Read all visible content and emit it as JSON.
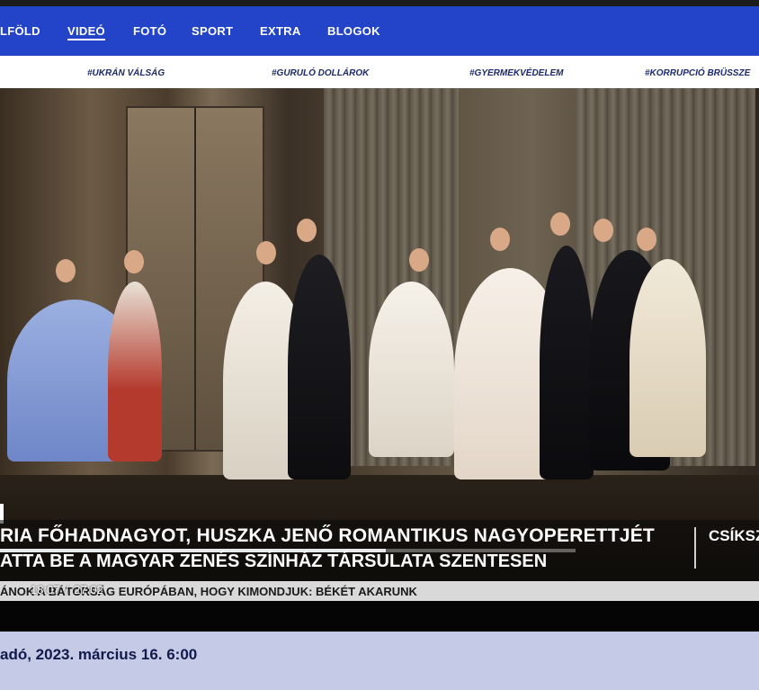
{
  "nav": {
    "items": [
      {
        "label": "LFÖLD",
        "active": false
      },
      {
        "label": "VIDEÓ",
        "active": true
      },
      {
        "label": "FOTÓ",
        "active": false
      },
      {
        "label": "SPORT",
        "active": false
      },
      {
        "label": "EXTRA",
        "active": false
      },
      {
        "label": "BLOGOK",
        "active": false
      }
    ]
  },
  "tags": [
    "#UKRÁN VÁLSÁG",
    "#GURULÓ DOLLÁROK",
    "#GYERMEKVÉDELEM",
    "#KORRUPCIÓ BRÜSSZE"
  ],
  "video": {
    "headline_line1": "RIA FŐHADNAGYOT, HUSZKA JENŐ ROMANTIKUS NAGYOPERETTJÉT",
    "headline_line2": "ATTA BE A MAGYAR ZENÉS SZÍNHÁZ TÁRSULATA SZENTESEN",
    "side_label": "CSÍKSZ",
    "ticker": "ÁNOK A BÁTORSÁG EURÓPÁBAN, HOGY KIMONDJUK: BÉKÉT AKARUNK",
    "current_time": "18:07",
    "separator": "/",
    "duration": "27:02",
    "progress": 0.67
  },
  "article": {
    "date_line": "adó, 2023. március 16. 6:00"
  },
  "colors": {
    "nav_bg": "#2344c9",
    "page_bg": "#c5cbe6",
    "tag_text": "#1d2a6b"
  }
}
